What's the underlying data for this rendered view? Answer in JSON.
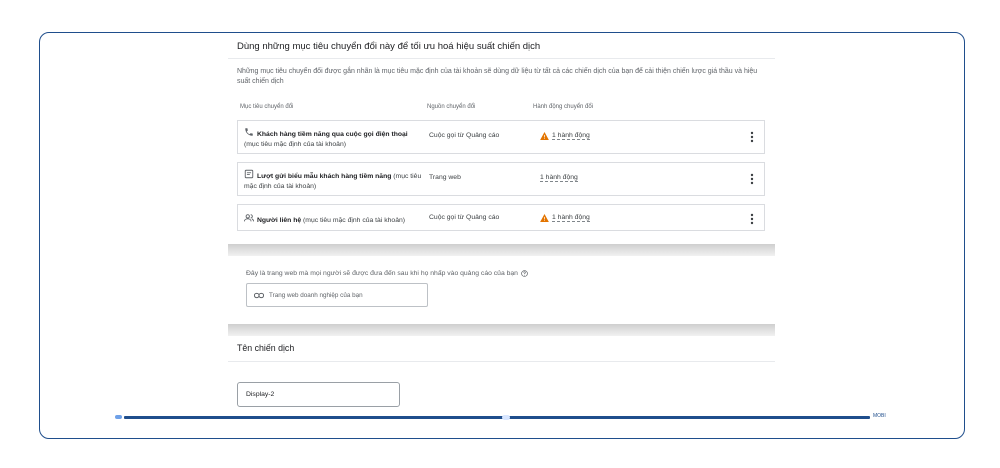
{
  "header": {
    "title": "Dùng những mục tiêu chuyển đổi này để tối ưu hoá hiệu suất chiến dịch",
    "description": "Những mục tiêu chuyển đổi được gắn nhãn là mục tiêu mặc định của tài khoản sẽ dùng dữ liệu từ tất cả các chiến dịch của bạn để cải thiện chiến lược giá thầu và hiệu suất chiến dịch"
  },
  "table": {
    "columns": [
      "Mục tiêu chuyển đổi",
      "Nguồn chuyển đổi",
      "Hành động chuyển đổi"
    ],
    "rows": [
      {
        "icon": "phone-icon",
        "title": "Khách hàng tiềm năng qua cuộc gọi điện thoại",
        "subtitle": "(mục tiêu mặc định của tài khoản)",
        "source": "Cuộc gọi từ Quảng cáo",
        "action": "1 hành động",
        "warning": true
      },
      {
        "icon": "form-icon",
        "title": "Lượt gửi biểu mẫu khách hàng tiềm năng",
        "subtitle": "(mục tiêu mặc định của tài khoản)",
        "source": "Trang web",
        "action": "1 hành động",
        "warning": false
      },
      {
        "icon": "people-icon",
        "title": "Người liên hệ",
        "subtitle": "(mục tiêu mặc định của tài khoản)",
        "source": "Cuộc gọi từ Quảng cáo",
        "action": "1 hành động",
        "warning": true
      }
    ]
  },
  "website": {
    "prompt": "Đây là trang web mà mọi người sẽ được đưa đến sau khi họ nhấp vào quảng cáo của bạn",
    "placeholder": "Trang web doanh nghiệp của bạn"
  },
  "campaign": {
    "section_title": "Tên chiến dịch",
    "name_value": "Display-2"
  },
  "footer": {
    "progress_label": "MOBI"
  },
  "colors": {
    "frame_border": "#1f4e8c",
    "warning": "#e37400",
    "divider": "#dadce0"
  }
}
